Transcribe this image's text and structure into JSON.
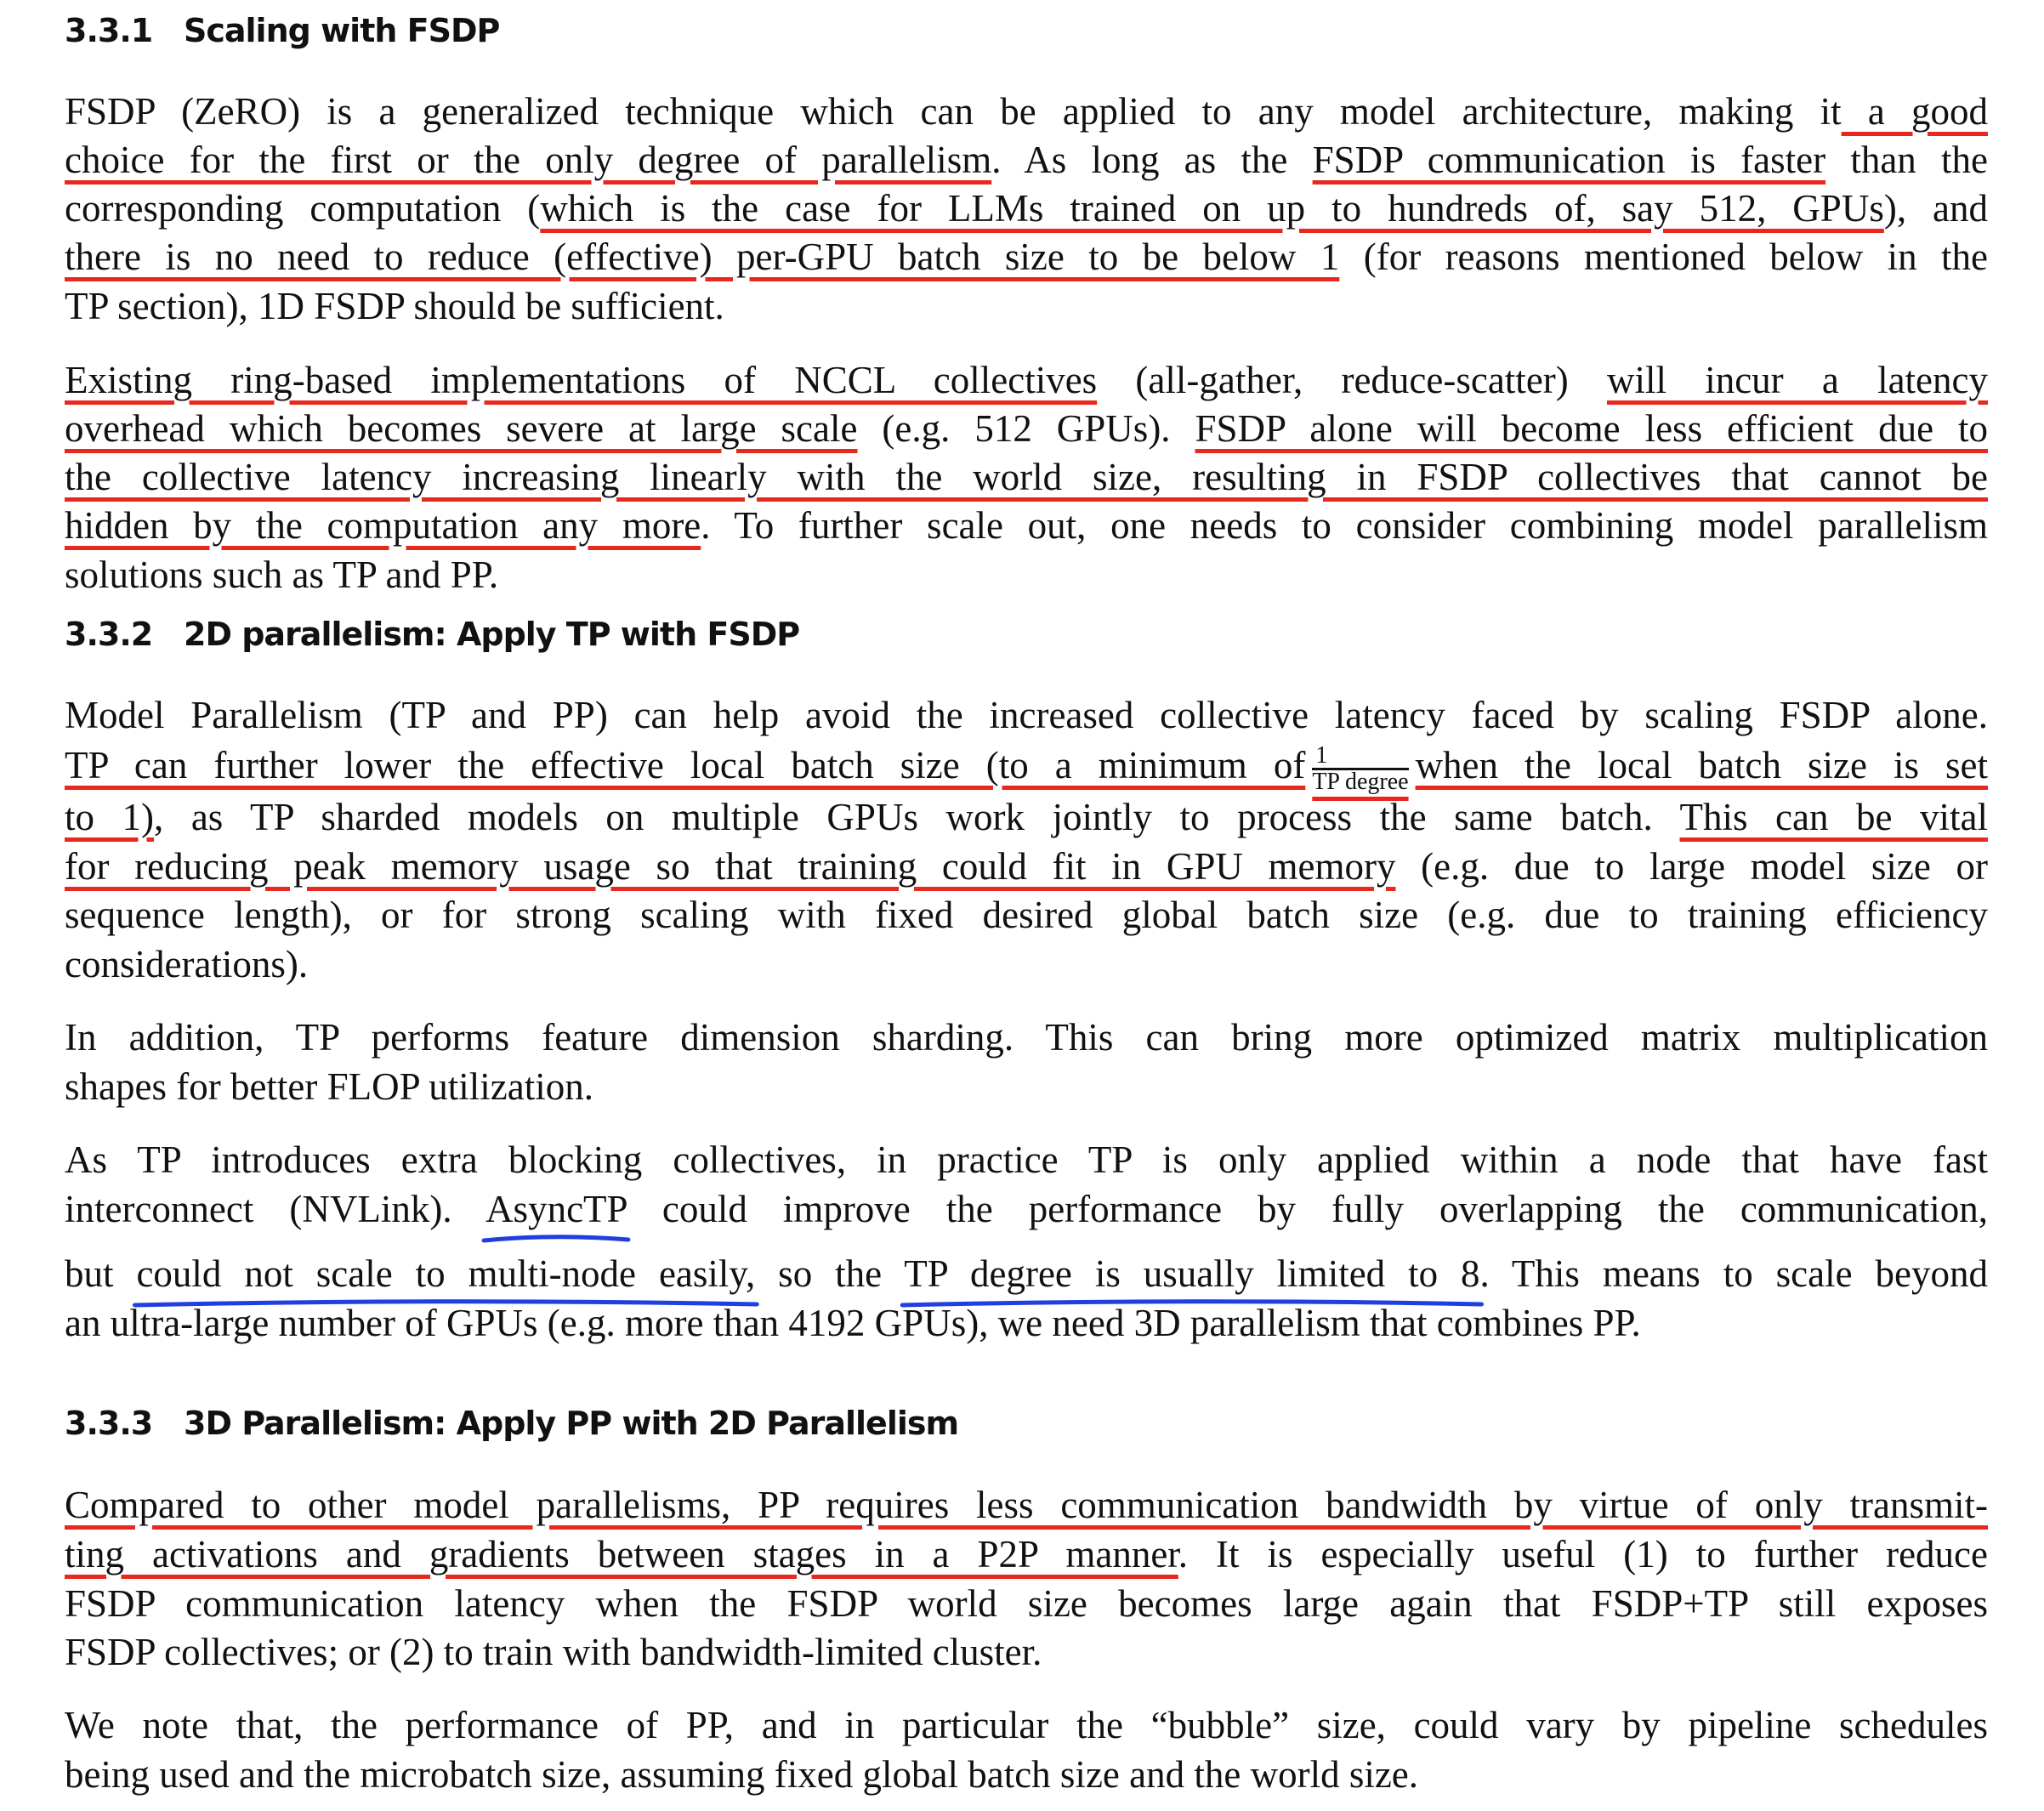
{
  "sections": [
    {
      "number": "3.3.1",
      "title": "Scaling with FSDP",
      "paragraphs": [
        {
          "lines": [
            [
              {
                "t": "FSDP (ZeRO) is a generalized technique which can be applied to any model architecture, making it"
              },
              {
                "t": " a good",
                "hl": "red"
              }
            ],
            [
              {
                "t": "choice for the first or the only degree of parallelism",
                "hl": "red"
              },
              {
                "t": ". As long as the "
              },
              {
                "t": "FSDP communication is faster",
                "hl": "red"
              },
              {
                "t": " than the"
              }
            ],
            [
              {
                "t": "corresponding computation ("
              },
              {
                "t": "which is the case for LLMs trained on up to hundreds of, say 512, GPUs",
                "hl": "red"
              },
              {
                "t": "), and"
              }
            ],
            [
              {
                "t": "there is no need to reduce (effective) per-GPU batch size to be below 1",
                "hl": "red"
              },
              {
                "t": " (for reasons mentioned below in the"
              }
            ],
            [
              {
                "t": "TP section), 1D FSDP should be sufficient."
              }
            ]
          ]
        },
        {
          "lines": [
            [
              {
                "t": "Existing ring-based implementations of NCCL collectives",
                "hl": "red"
              },
              {
                "t": " (all-gather, reduce-scatter) "
              },
              {
                "t": "will incur a latency",
                "hl": "red"
              }
            ],
            [
              {
                "t": "overhead which becomes severe at large scale",
                "hl": "red"
              },
              {
                "t": " (e.g. 512 GPUs). "
              },
              {
                "t": "FSDP alone will become less efficient due to",
                "hl": "red"
              }
            ],
            [
              {
                "t": "the collective latency increasing linearly with the world size, resulting in FSDP collectives that cannot be",
                "hl": "red"
              }
            ],
            [
              {
                "t": "hidden by the computation any more",
                "hl": "red"
              },
              {
                "t": ". To further scale out, one needs to consider combining model parallelism"
              }
            ],
            [
              {
                "t": "solutions such as TP and PP."
              }
            ]
          ]
        }
      ]
    },
    {
      "number": "3.3.2",
      "title": "2D parallelism: Apply TP with FSDP",
      "paragraphs": [
        {
          "lines": [
            [
              {
                "t": "Model Parallelism (TP and PP) can help avoid the increased collective latency faced by scaling FSDP alone."
              }
            ],
            [
              {
                "t": "TP can further lower the effective local batch size (to a minimum of",
                "hl": "red"
              },
              {
                "frac": [
                  "1",
                  "TP degree"
                ],
                "hl": "red"
              },
              {
                "t": "when the local batch size is set",
                "hl": "red"
              }
            ],
            [
              {
                "t": "to 1)",
                "hl": "red"
              },
              {
                "t": ", as TP sharded models on multiple GPUs work jointly to process the same batch. "
              },
              {
                "t": "This can be vital",
                "hl": "red"
              }
            ],
            [
              {
                "t": "for reducing peak memory usage so that training could fit in GPU memory",
                "hl": "red"
              },
              {
                "t": " (e.g. due to large model size or"
              }
            ],
            [
              {
                "t": "sequence length), or for strong scaling with fixed desired global batch size (e.g. due to training efficiency"
              }
            ],
            [
              {
                "t": "considerations)."
              }
            ]
          ]
        },
        {
          "lines": [
            [
              {
                "t": "In addition, TP performs feature dimension sharding. This can bring more optimized matrix multiplication"
              }
            ],
            [
              {
                "t": "shapes for better FLOP utilization."
              }
            ]
          ]
        },
        {
          "lines": [
            [
              {
                "t": "As TP introduces extra blocking collectives, in practice TP is only applied within a node that have fast"
              }
            ],
            [
              {
                "t": "interconnect (NVLink). "
              },
              {
                "t": "AsyncTP",
                "hl": "blue"
              },
              {
                "t": " could improve the performance by fully overlapping the communication,"
              }
            ],
            [
              {
                "t": "but "
              },
              {
                "t": "could not scale to multi-node easily,",
                "hl": "blue"
              },
              {
                "t": " so the "
              },
              {
                "t": "TP degree is usually limited to 8",
                "hl": "blue"
              },
              {
                "t": ". This means to scale beyond"
              }
            ],
            [
              {
                "t": "an ultra-large number of GPUs (e.g. more than 4192 GPUs), we need 3D parallelism that combines PP."
              }
            ]
          ]
        }
      ]
    },
    {
      "number": "3.3.3",
      "title": "3D Parallelism: Apply PP with 2D Parallelism",
      "paragraphs": [
        {
          "lines": [
            [
              {
                "t": "Compared to other model parallelisms, PP requires less communication bandwidth by virtue of only transmit-",
                "hl": "red"
              }
            ],
            [
              {
                "t": "ting activations and gradients between stages in a P2P manner",
                "hl": "red"
              },
              {
                "t": ". It is especially useful (1) to further reduce"
              }
            ],
            [
              {
                "t": "FSDP communication latency when the FSDP world size becomes large again that FSDP+TP still exposes"
              }
            ],
            [
              {
                "t": "FSDP collectives; or (2) to train with bandwidth-limited cluster."
              }
            ]
          ]
        },
        {
          "lines": [
            [
              {
                "t": "We note that, the performance of PP, and in particular the “bubble” size, could vary by pipeline schedules"
              }
            ],
            [
              {
                "t": "being used and the microbatch size, assuming fixed global batch size and the world size."
              }
            ]
          ]
        }
      ]
    }
  ],
  "annotation_colors": {
    "red": "#e8281e",
    "blue": "#1f3fe0"
  }
}
